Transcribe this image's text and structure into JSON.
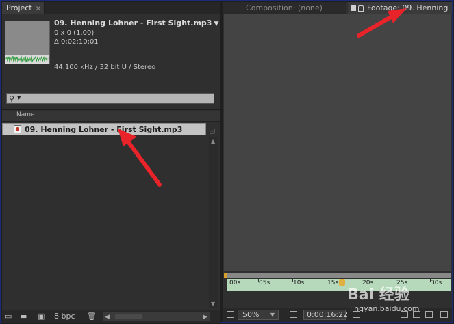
{
  "project_panel": {
    "tab_label": "Project",
    "tab_close": "×",
    "item_info": {
      "title": "09. Henning Lohner - First Sight.mp3",
      "dimensions": "0 x 0 (1.00)",
      "duration": "Δ 0:02:10:01",
      "audio": "44.100 kHz / 32 bit U / Stereo"
    },
    "search": {
      "value": "",
      "placeholder": ""
    },
    "column_name": "Name",
    "items": [
      {
        "label": "09. Henning Lohner - First Sight.mp3",
        "selected": true
      }
    ],
    "footer": {
      "bpc": "8 bpc"
    }
  },
  "viewer_panel": {
    "tab_composition": "Composition: (none)",
    "tab_footage": "Footage: 09. Henning",
    "timeline_ticks": [
      "00s",
      "05s",
      "10s",
      "15s",
      "20s",
      "25s",
      "30s"
    ],
    "zoom": "50%",
    "timecode": "0:00:16:22"
  },
  "watermark": {
    "brand": "Bai 经验",
    "domain": "jingyan.baidu.com"
  },
  "colors": {
    "annotation_arrow": "#e8242a",
    "timeline_ruler": "#b7d9bb",
    "selected_row": "#c3c3c3"
  }
}
